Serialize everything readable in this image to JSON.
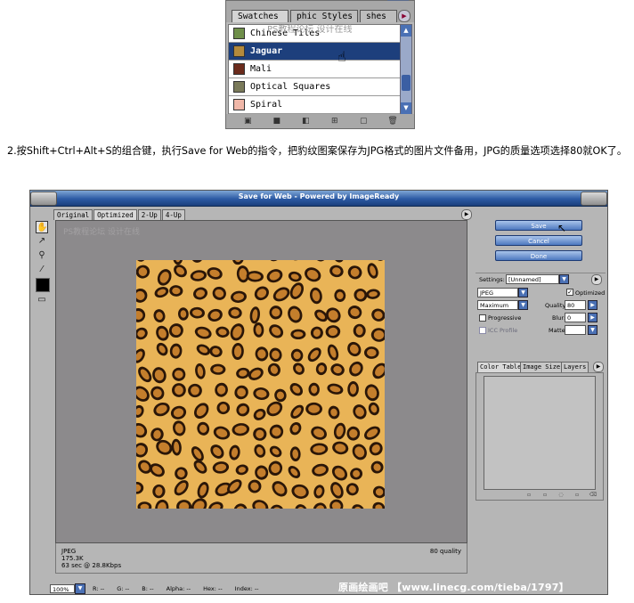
{
  "swatches_panel": {
    "tabs": [
      "Swatches",
      "phic Styles",
      "shes"
    ],
    "watermark": "PS教程论坛 设计在线",
    "items": [
      {
        "label": "Chinese Tiles",
        "color": "#6f8f4a",
        "selected": false
      },
      {
        "label": "Jaguar",
        "color": "#b48a3c",
        "selected": true
      },
      {
        "label": "Mali",
        "color": "#6b2b1c",
        "selected": false
      },
      {
        "label": "Optical Squares",
        "color": "#7a7a5a",
        "selected": false
      },
      {
        "label": "Spiral",
        "color": "#f0b7a8",
        "selected": false
      }
    ],
    "bottom_icons": [
      "styles-icon",
      "square-icon",
      "gradient-icon",
      "grid-icon",
      "new-icon",
      "trash-icon"
    ]
  },
  "instruction": "2.按Shift+Ctrl+Alt+S的组合键，执行Save for Web的指令，把豹纹图案保存为JPG格式的图片文件备用，JPG的质量选项选择80就OK了。",
  "save_for_web": {
    "title": "Save for Web - Powered by ImageReady",
    "view_tabs": [
      "Original",
      "Optimized",
      "2-Up",
      "4-Up"
    ],
    "active_view": "Optimized",
    "view_watermark": "PS教程论坛 设计在线",
    "buttons": {
      "save": "Save",
      "cancel": "Cancel",
      "done": "Done"
    },
    "settings": {
      "label": "Settings:",
      "value": "[Unnamed]",
      "format": "JPEG",
      "quality_level": "Maximum",
      "optimized_label": "Optimized",
      "optimized_checked": true,
      "quality_label": "Quality:",
      "quality_value": "80",
      "progressive_label": "Progressive",
      "progressive_checked": false,
      "blur_label": "Blur:",
      "blur_value": "0",
      "icc_label": "ICC Profile",
      "matte_label": "Matte:"
    },
    "color_tabs": [
      "Color Table",
      "Image Size",
      "Layers"
    ],
    "info": {
      "format": "JPEG",
      "size": "175.3K",
      "time": "63 sec @ 28.8Kbps",
      "quality": "80 quality"
    },
    "status": {
      "zoom": "100%",
      "fields": [
        "R: --",
        "G: --",
        "B: --",
        "Alpha: --",
        "Hex: --",
        "Index: --"
      ]
    },
    "footer_watermark": "原画绘画吧 【www.linecg.com/tieba/1797】"
  }
}
